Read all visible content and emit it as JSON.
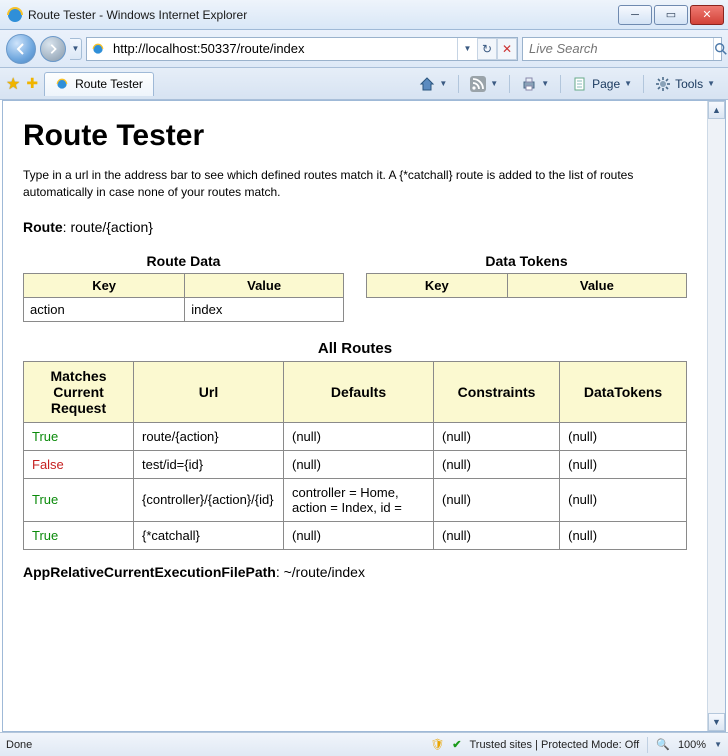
{
  "window": {
    "title": "Route Tester - Windows Internet Explorer"
  },
  "nav": {
    "url": "http://localhost:50337/route/index",
    "search_placeholder": "Live Search"
  },
  "tab": {
    "label": "Route Tester"
  },
  "cmd": {
    "page": "Page",
    "tools": "Tools"
  },
  "page": {
    "heading": "Route Tester",
    "description": "Type in a url in the address bar to see which defined routes match it. A {*catchall} route is added to the list of routes automatically in case none of your routes match.",
    "route_label": "Route",
    "route_value": "route/{action}",
    "route_data_title": "Route Data",
    "data_tokens_title": "Data Tokens",
    "col_key": "Key",
    "col_value": "Value",
    "route_data_rows": [
      {
        "key": "action",
        "value": "index"
      }
    ],
    "all_routes_title": "All Routes",
    "all_cols": {
      "matches": "Matches Current Request",
      "url": "Url",
      "defaults": "Defaults",
      "constraints": "Constraints",
      "datatokens": "DataTokens"
    },
    "all_rows": [
      {
        "match": "True",
        "url": "route/{action}",
        "defaults": "(null)",
        "constraints": "(null)",
        "datatokens": "(null)"
      },
      {
        "match": "False",
        "url": "test/id={id}",
        "defaults": "(null)",
        "constraints": "(null)",
        "datatokens": "(null)"
      },
      {
        "match": "True",
        "url": "{controller}/{action}/{id}",
        "defaults": "controller = Home, action = Index, id = ",
        "constraints": "(null)",
        "datatokens": "(null)"
      },
      {
        "match": "True",
        "url": "{*catchall}",
        "defaults": "(null)",
        "constraints": "(null)",
        "datatokens": "(null)"
      }
    ],
    "app_path_label": "AppRelativeCurrentExecutionFilePath",
    "app_path_value": "~/route/index"
  },
  "status": {
    "done": "Done",
    "zone": "Trusted sites | Protected Mode: Off",
    "zoom": "100%"
  }
}
